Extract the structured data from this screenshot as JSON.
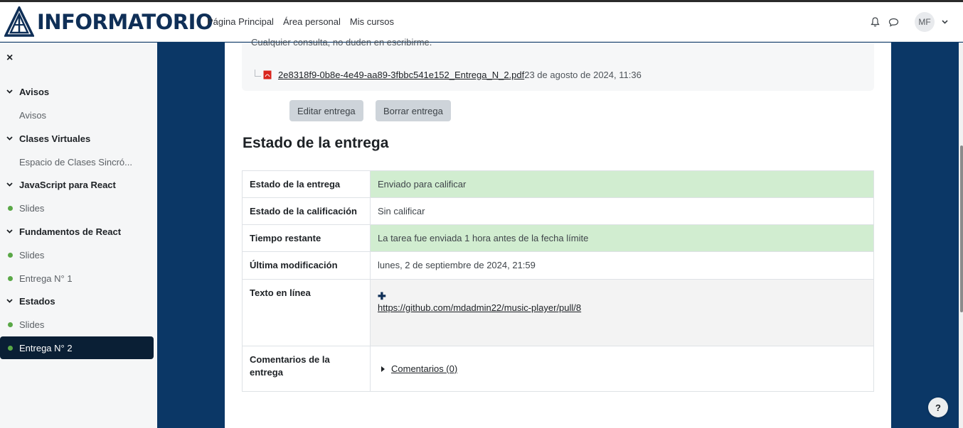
{
  "brand": {
    "name": "INFORMATORIO",
    "color": "#0f2f57"
  },
  "nav": {
    "links": [
      "Página Principal",
      "Área personal",
      "Mis cursos"
    ],
    "user_initials": "MF"
  },
  "icons": {
    "notifications": "bell-icon",
    "messages": "chat-bubble-icon",
    "menu": "chevron-down-icon",
    "close": "close-icon"
  },
  "sidebar": {
    "close_label": "×",
    "items": [
      {
        "type": "section",
        "label": "Avisos"
      },
      {
        "type": "link",
        "label": "Avisos"
      },
      {
        "type": "section",
        "label": "Clases Virtuales"
      },
      {
        "type": "link",
        "label": "Espacio de Clases Sincró..."
      },
      {
        "type": "section",
        "label": "JavaScript para React"
      },
      {
        "type": "activity",
        "label": "Slides"
      },
      {
        "type": "section",
        "label": "Fundamentos de React"
      },
      {
        "type": "activity",
        "label": "Slides"
      },
      {
        "type": "activity",
        "label": "Entrega N° 1"
      },
      {
        "type": "section",
        "label": "Estados"
      },
      {
        "type": "activity",
        "label": "Slides"
      },
      {
        "type": "activity",
        "label": "Entrega N° 2",
        "active": true
      }
    ]
  },
  "submission": {
    "cut_text": "Cualquier consulta, no duden en escribirme.",
    "file_name": "2e8318f9-0b8e-4e49-aa89-3fbbc541e152_Entrega_N_2.pdf",
    "file_date": "23 de agosto de 2024, 11:36",
    "edit_button": "Editar entrega",
    "delete_button": "Borrar entrega"
  },
  "status": {
    "heading": "Estado de la entrega",
    "rows": [
      {
        "key": "Estado de la entrega",
        "value": "Enviado para calificar"
      },
      {
        "key": "Estado de la calificación",
        "value": "Sin calificar"
      },
      {
        "key": "Tiempo restante",
        "value": "La tarea fue enviada 1 hora antes de la fecha límite"
      },
      {
        "key": "Última modificación",
        "value": "lunes, 2 de septiembre de 2024, 21:59"
      },
      {
        "key": "Texto en línea",
        "plus": "✚",
        "value": "https://github.com/mdadmin22/music-player/pull/8"
      },
      {
        "key": "Comentarios de la entrega",
        "value": "Comentarios (0)"
      }
    ]
  },
  "help": {
    "label": "?"
  },
  "colors": {
    "status_green": "#d1edd0",
    "dark_blue_bg": "#0b3766",
    "active_item": "#0a1f35",
    "dot_green": "#5aa847"
  }
}
